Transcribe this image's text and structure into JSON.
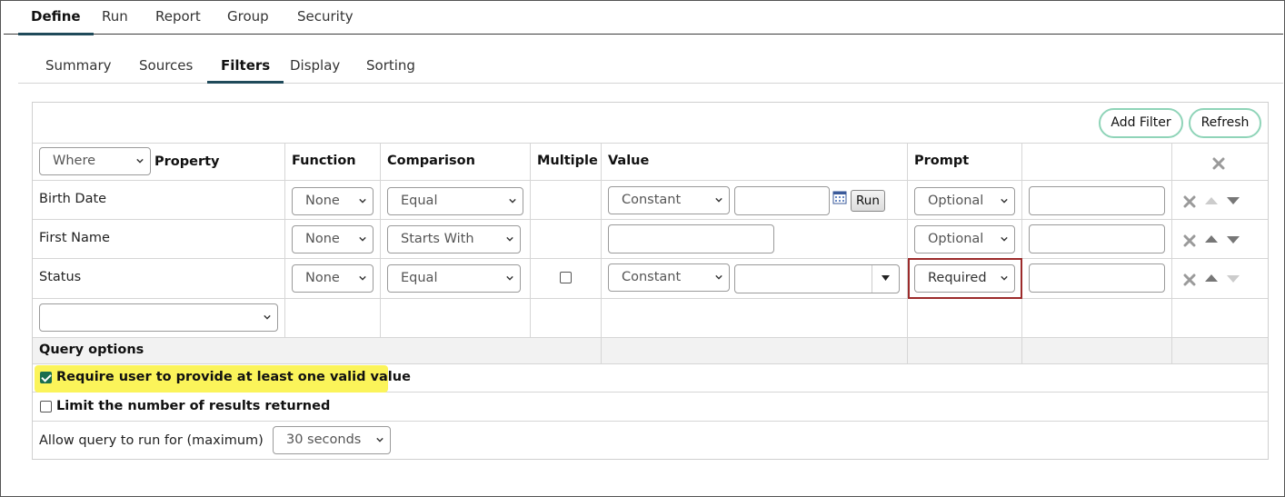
{
  "top_tabs": [
    {
      "label": "Define",
      "active": true
    },
    {
      "label": "Run",
      "active": false
    },
    {
      "label": "Report",
      "active": false
    },
    {
      "label": "Group",
      "active": false
    },
    {
      "label": "Security",
      "active": false
    }
  ],
  "sub_tabs": [
    {
      "label": "Summary",
      "active": false
    },
    {
      "label": "Sources",
      "active": false
    },
    {
      "label": "Filters",
      "active": true
    },
    {
      "label": "Display",
      "active": false
    },
    {
      "label": "Sorting",
      "active": false
    }
  ],
  "toolbar": {
    "add_filter": "Add Filter",
    "refresh": "Refresh"
  },
  "filters": {
    "where_select": "Where",
    "headers": {
      "property": "Property",
      "function": "Function",
      "comparison": "Comparison",
      "multiple": "Multiple",
      "value": "Value",
      "prompt": "Prompt"
    },
    "rows": [
      {
        "property": "Birth Date",
        "function": "None",
        "comparison": "Equal",
        "value_type": "Constant",
        "prompt": "Optional",
        "run_label": "Run"
      },
      {
        "property": "First Name",
        "function": "None",
        "comparison": "Starts With",
        "prompt": "Optional"
      },
      {
        "property": "Status",
        "function": "None",
        "comparison": "Equal",
        "multiple_checked": false,
        "value_type": "Constant",
        "prompt": "Required"
      }
    ],
    "add_property_select": ""
  },
  "query_options": {
    "title": "Query options",
    "require_value": {
      "label": "Require user to provide at least one valid value",
      "checked": true
    },
    "limit_results": {
      "label": "Limit the number of results returned",
      "checked": false
    },
    "max_time": {
      "label": "Allow query to run for (maximum)",
      "value": "30 seconds"
    }
  },
  "colors": {
    "accent": "#1f4a5a",
    "pill_border": "#8fd4b8",
    "highlight": "#fbf45a",
    "callout": "#9c2b2b"
  }
}
